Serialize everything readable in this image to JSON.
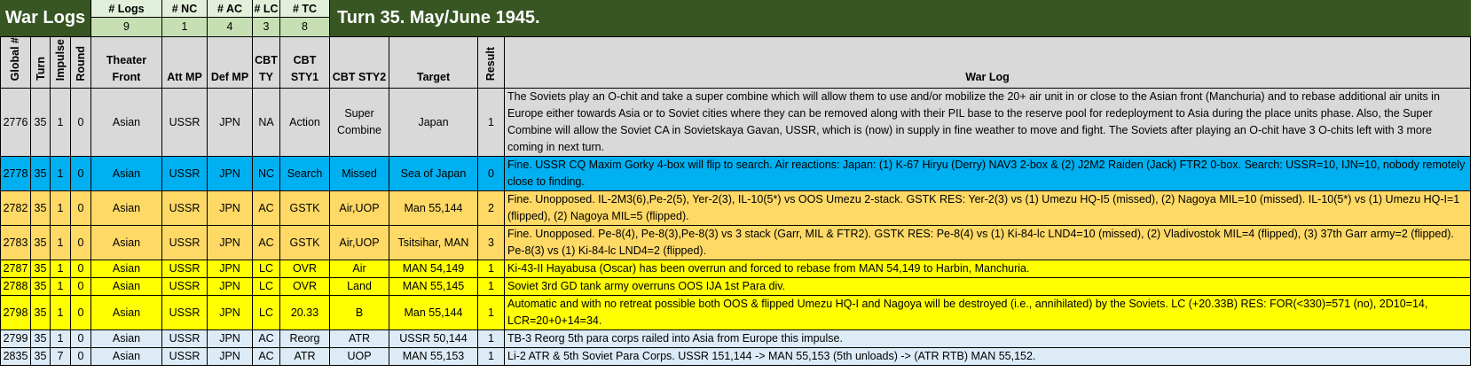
{
  "title": "War Logs",
  "turn_title": "Turn 35.  May/June 1945.",
  "stats": [
    {
      "label": "# Logs",
      "value": "9"
    },
    {
      "label": "# NC",
      "value": "1"
    },
    {
      "label": "# AC",
      "value": "4"
    },
    {
      "label": "# LC",
      "value": "3"
    },
    {
      "label": "# TC",
      "value": "8"
    }
  ],
  "columns": [
    "Global #",
    "Turn",
    "Impulse",
    "Round",
    "Theater Front",
    "Att MP",
    "Def MP",
    "CBT TY",
    "CBT STY1",
    "CBT STY2",
    "Target",
    "Result",
    "War Log"
  ],
  "rows": [
    {
      "style": "gray",
      "cells": [
        "2776",
        "35",
        "1",
        "0",
        "Asian",
        "USSR",
        "JPN",
        "NA",
        "Action",
        "Super Combine",
        "Japan",
        "1"
      ],
      "log": "The Soviets play an O-chit and take a super combine which will allow them to use and/or mobilize the 20+ air unit in or close to the Asian front (Manchuria) and to rebase additional air units in Europe either towards Asia or to Soviet cities where they can be removed along with their PIL base to the reserve pool for redeployment to Asia during the place units phase.  Also, the Super Combine will allow the Soviet CA in Sovietskaya Gavan, USSR, which is (now) in supply in fine weather to move and fight.  The Soviets after playing an O-chit have 3 O-chits left with 3 more coming in next turn."
    },
    {
      "style": "blue",
      "cells": [
        "2778",
        "35",
        "1",
        "0",
        "Asian",
        "USSR",
        "JPN",
        "NC",
        "Search",
        "Missed",
        "Sea of Japan",
        "0"
      ],
      "log": "Fine.  USSR CQ Maxim Gorky 4-box will flip to search.  Air reactions:  Japan:  (1) K-67 Hiryu (Derry) NAV3 2-box & (2) J2M2 Raiden (Jack) FTR2 0-box.  Search:   USSR=10, IJN=10, nobody remotely close to finding."
    },
    {
      "style": "orange",
      "cells": [
        "2782",
        "35",
        "1",
        "0",
        "Asian",
        "USSR",
        "JPN",
        "AC",
        "GSTK",
        "Air,UOP",
        "Man 55,144",
        "2"
      ],
      "log": "Fine.  Unopposed.  IL-2M3(6),Pe-2(5), Yer-2(3), IL-10(5*) vs OOS Umezu 2-stack.  GSTK RES:  Yer-2(3) vs (1) Umezu HQ-I5 (missed), (2) Nagoya MIL=10 (missed).  IL-10(5*) vs (1) Umezu HQ-I=1 (flipped), (2) Nagoya MIL=5 (flipped)."
    },
    {
      "style": "orange",
      "cells": [
        "2783",
        "35",
        "1",
        "0",
        "Asian",
        "USSR",
        "JPN",
        "AC",
        "GSTK",
        "Air,UOP",
        "Tsitsihar, MAN",
        "3"
      ],
      "log": "Fine.  Unopposed.  Pe-8(4), Pe-8(3),Pe-8(3) vs 3 stack (Garr, MIL & FTR2).  GSTK RES:  Pe-8(4) vs (1) Ki-84-lc LND4=10 (missed), (2) Vladivostok MIL=4 (flipped), (3) 37th Garr army=2 (flipped).  Pe-8(3) vs (1) Ki-84-lc LND4=2 (flipped)."
    },
    {
      "style": "yellow",
      "cells": [
        "2787",
        "35",
        "1",
        "0",
        "Asian",
        "USSR",
        "JPN",
        "LC",
        "OVR",
        "Air",
        "MAN 54,149",
        "1"
      ],
      "log": "Ki-43-II Hayabusa (Oscar) has been overrun and forced to rebase from MAN 54,149 to Harbin, Manchuria."
    },
    {
      "style": "yellow",
      "cells": [
        "2788",
        "35",
        "1",
        "0",
        "Asian",
        "USSR",
        "JPN",
        "LC",
        "OVR",
        "Land",
        "MAN 55,145",
        "1"
      ],
      "log": "Soviet 3rd GD tank army overruns OOS IJA 1st Para div."
    },
    {
      "style": "yellow",
      "cells": [
        "2798",
        "35",
        "1",
        "0",
        "Asian",
        "USSR",
        "JPN",
        "LC",
        "20.33",
        "B",
        "Man 55,144",
        "1"
      ],
      "log": "Automatic and with no retreat possible both OOS & flipped Umezu HQ-I and Nagoya will be destroyed (i.e., annihilated) by the Soviets.  LC (+20.33B) RES:  FOR(<330)=571 (no), 2D10=14, LCR=20+0+14=34."
    },
    {
      "style": "lblue",
      "cells": [
        "2799",
        "35",
        "1",
        "0",
        "Asian",
        "USSR",
        "JPN",
        "AC",
        "Reorg",
        "ATR",
        "USSR 50,144",
        "1"
      ],
      "log": "TB-3 Reorg 5th para corps railed into Asia from Europe this impulse."
    },
    {
      "style": "lblue",
      "cells": [
        "2835",
        "35",
        "7",
        "0",
        "Asian",
        "USSR",
        "JPN",
        "AC",
        "ATR",
        "UOP",
        "MAN 55,153",
        "1"
      ],
      "log": "Li-2 ATR & 5th Soviet Para Corps.  USSR 151,144 -> MAN 55,153 (5th unloads) -> (ATR RTB) MAN 55,152."
    }
  ]
}
